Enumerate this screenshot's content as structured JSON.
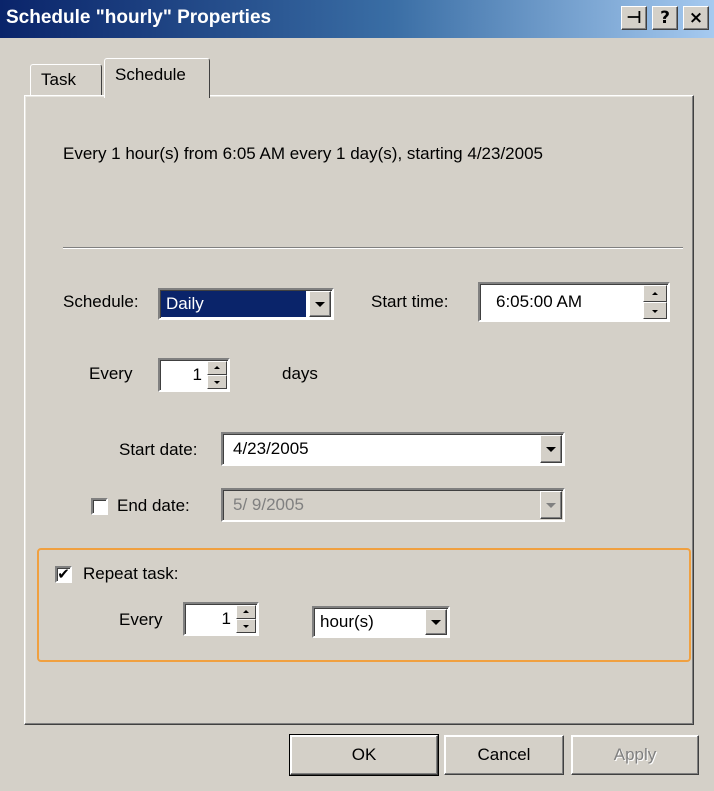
{
  "window": {
    "title": "Schedule \"hourly\" Properties",
    "controls": {
      "pin": "⊣",
      "help": "?",
      "close": "×"
    }
  },
  "tabs": [
    {
      "label": "Task",
      "active": false
    },
    {
      "label": "Schedule",
      "active": true
    }
  ],
  "summary": "Every 1 hour(s) from 6:05 AM every 1 day(s), starting 4/23/2005",
  "schedule": {
    "label": "Schedule:",
    "value": "Daily",
    "start_time_label": "Start time:",
    "start_time_value": "6:05:00 AM"
  },
  "every_days": {
    "label": "Every",
    "value": "1",
    "unit": "days"
  },
  "start_date": {
    "label": "Start date:",
    "value": "4/23/2005"
  },
  "end_date": {
    "label": "End date:",
    "value": "5/ 9/2005",
    "checked": false
  },
  "repeat": {
    "label": "Repeat task:",
    "checked": true,
    "every_label": "Every",
    "every_value": "1",
    "unit_value": "hour(s)"
  },
  "buttons": {
    "ok": "OK",
    "cancel": "Cancel",
    "apply": "Apply"
  },
  "colors": {
    "highlight_border": "#f0a040",
    "selection": "#0a246a",
    "face": "#d4d0c8"
  }
}
